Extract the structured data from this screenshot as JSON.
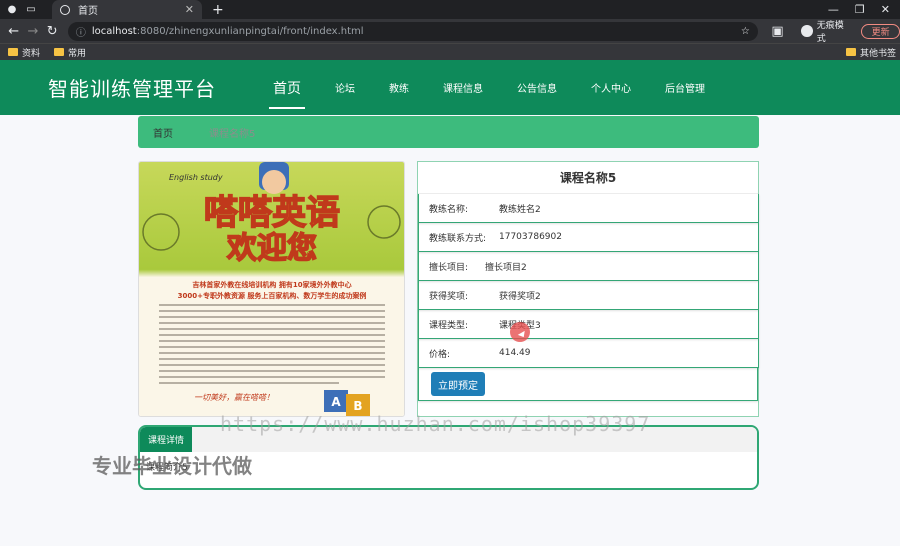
{
  "browser": {
    "tab_title": "首页",
    "url_host": "localhost",
    "url_path": ":8080/zhinengxunlianpingtai/front/index.html",
    "incognito_label": "无痕模式",
    "update_label": "更新",
    "bookmarks": [
      "资料",
      "常用"
    ],
    "other_bookmarks": "其他书签"
  },
  "header": {
    "logo": "智能训练管理平台",
    "menu": [
      "首页",
      "论坛",
      "教练",
      "课程信息",
      "公告信息",
      "个人中心",
      "后台管理"
    ]
  },
  "breadcrumb": {
    "home": "首页",
    "current": "课程名称5"
  },
  "poster": {
    "tag": "English study",
    "headline": "嗒嗒英语",
    "subheadline": "欢迎您",
    "line1": "吉林首家外教在线培训机构  拥有10家境外外教中心",
    "line2": "3000+专职外教资源  服务上百家机构、数万学生的成功案例",
    "signature": "一切美好，赢在嗒嗒！",
    "blocks": [
      "A",
      "B"
    ]
  },
  "course": {
    "title": "课程名称5",
    "fields": [
      {
        "label": "教练名称:",
        "value": "教练姓名2"
      },
      {
        "label": "教练联系方式:",
        "value": "17703786902"
      },
      {
        "label": "擅长项目:",
        "value": "擅长项目2"
      },
      {
        "label": "获得奖项:",
        "value": "获得奖项2"
      },
      {
        "label": "课程类型:",
        "value": "课程类型3"
      },
      {
        "label": "价格:",
        "value": "414.49"
      }
    ],
    "book_button": "立即预定"
  },
  "detail": {
    "tab": "课程详情",
    "intro": "课程简介5"
  },
  "watermark": {
    "url": "https://www.huzhan.com/ishop39397",
    "text": "专业毕业设计代做"
  },
  "colors": {
    "header_bg": "#0e8a5a",
    "breadcrumb_bg": "#3dbb7d",
    "button_bg": "#1f7eb7"
  }
}
